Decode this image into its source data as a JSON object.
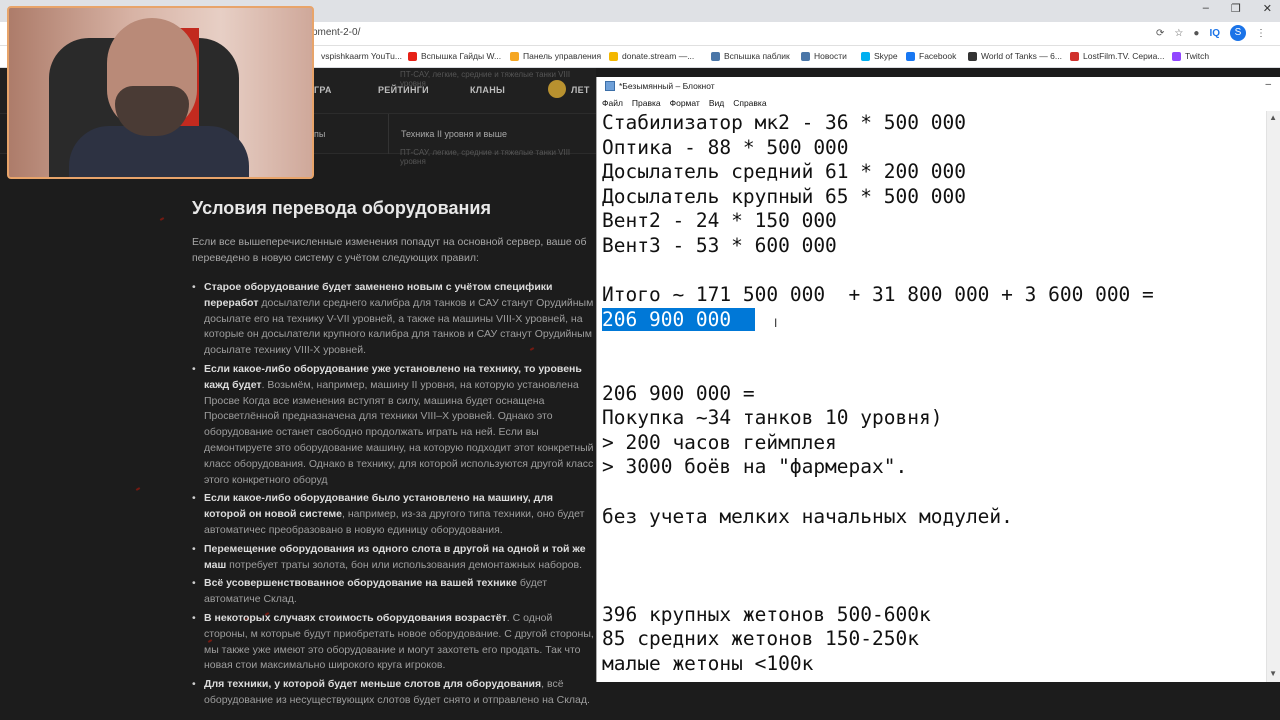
{
  "browser": {
    "url": "pment-2-0/",
    "window_controls": [
      "–",
      "❐",
      "✕"
    ],
    "extensions": {
      "iq": "IQ",
      "profile": "S"
    },
    "bookmarks": [
      "vspishkaarm YouTu...",
      "Вспышка Гайды W...",
      "Панель управления",
      "donate.stream —...",
      "Вспышка паблик",
      "Новости",
      "Skype",
      "Facebook",
      "World of Tanks — 6...",
      "LostFilm.TV. Сериа...",
      "Twitch"
    ],
    "bookmark_colors": [
      "#ffffff",
      "#e62117",
      "#f5a623",
      "#f3b700",
      "#4a76a8",
      "#4a76a8",
      "#00aff0",
      "#1877f2",
      "#333333",
      "#d0312d",
      "#9146ff"
    ]
  },
  "site": {
    "nav": {
      "item1": "ГРА",
      "item2": "РЕЙТИНГИ",
      "item3": "КЛАНЫ",
      "item4": "ЛЕТ"
    },
    "nav_subtext": "ПТ-САУ, легкие, средние и тяжелые танки VIII уровня",
    "nav_subtext2": "ПТ-САУ, легкие, средние и тяжелые танки VIII уровня",
    "subnav": {
      "item1": "пы",
      "item2": "Техника II уровня и выше"
    },
    "heading": "Условия перевода оборудования",
    "intro": "Если все вышеперечисленные изменения попадут на основной сервер, ваше об переведено в новую систему с учётом следующих правил:",
    "bullets": [
      {
        "bold": "Старое оборудование будет заменено новым с учётом специфики переработ",
        "text": " досылатели среднего калибра для танков и САУ станут Орудийным досылате его на технику V-VII уровней, а также на машины VIII-X уровней, на которые он досылатели крупного калибра для танков и САУ станут Орудийным досылате технику VIII-X уровней."
      },
      {
        "bold": "Если какое-либо оборудование уже установлено на технику, то уровень кажд будет",
        "text": ". Возьмём, например, машину II уровня, на которую установлена Просве Когда все изменения вступят в силу, машина будет оснащена Просветлённой предназначена для техники VIII–X уровней. Однако это оборудование останет свободно продолжать играть на ней. Если вы демонтируете это оборудование машину, на которую подходит этот конкретный класс оборудования. Однако в технику, для которой используются другой класс этого конкретного оборуд"
      },
      {
        "bold": "Если какое-либо оборудование было установлено на машину, для которой он новой системе",
        "text": ", например, из-за другого типа техники, оно будет автоматичес преобразовано в новую единицу оборудования."
      },
      {
        "bold": "Перемещение оборудования из одного слота в другой на одной и той же маш",
        "text": " потребует траты золота, бон или использования демонтажных наборов."
      },
      {
        "bold": "Всё усовершенствованное оборудование на вашей технике",
        "text": " будет автоматиче Склад."
      },
      {
        "bold": "В некоторых случаях стоимость оборудования возрастёт",
        "text": ". С одной стороны, м которые будут приобретать новое оборудование. С другой стороны, мы также уже имеют это оборудование и могут захотеть его продать. Так что новая стои максимально широкого круга игроков."
      },
      {
        "bold": "Для техники, у которой будет меньше слотов для оборудования",
        "text": ", всё оборудование из несуществующих слотов будет снято и отправлено на Склад."
      }
    ]
  },
  "notepad": {
    "title": "*Безымянный – Блокнот",
    "menu": [
      "Файл",
      "Правка",
      "Формат",
      "Вид",
      "Справка"
    ],
    "lines": [
      "Стабилизатор мк2 - 36 * 500 000",
      "Оптика - 88 * 500 000",
      "Досылатель средний 61 * 200 000",
      "Досылатель крупный 65 * 500 000",
      "Вент2 - 24 * 150 000",
      "Вент3 - 53 * 600 000",
      "",
      "Итого ~ 171 500 000  + 31 800 000 + 3 600 000 =",
      "206 900 000",
      "",
      "",
      "206 900 000 =",
      "Покупка ~34 танков 10 уровня)",
      "> 200 часов геймплея",
      "> 3000 боёв на \"фармерах\".",
      "",
      "без учета мелких начальных модулей.",
      "",
      "",
      "",
      "396 крупных жетонов 500-600к",
      "85 средних жетонов 150-250к",
      "малые жетоны <100к"
    ],
    "selected_line_index": 8,
    "selection_trailing": "  "
  },
  "icons": {
    "cursor": "text-cursor-icon",
    "minimize": "minimize-icon"
  }
}
